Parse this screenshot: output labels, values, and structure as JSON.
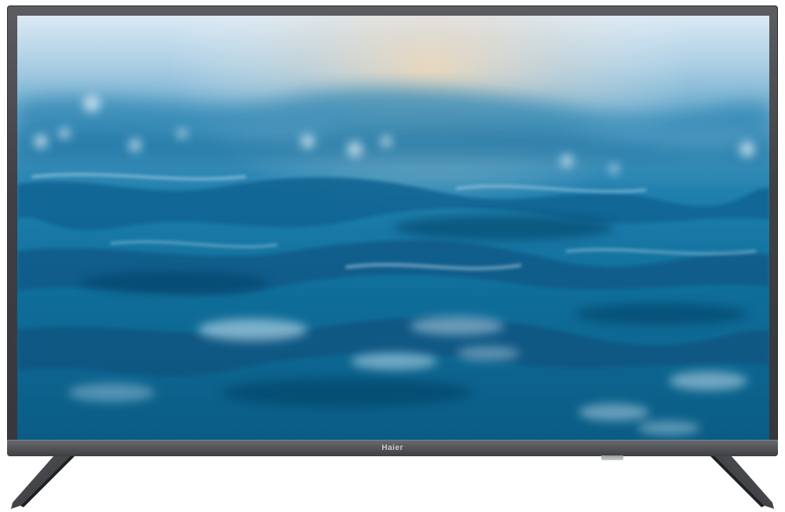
{
  "product": {
    "brand_logo": "Haier",
    "frame_color": "#3f4145",
    "screen_color_top": "#cfe6f5",
    "screen_color_bottom": "#0b5e86",
    "screen_image": "ocean-waves-photo"
  }
}
